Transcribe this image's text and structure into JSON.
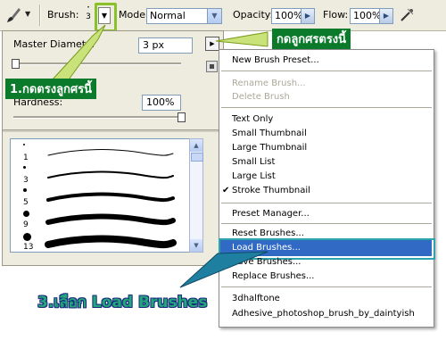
{
  "toolbar": {
    "tool_icon": "paintbrush-icon",
    "brush_label": "Brush:",
    "brush_size": "3",
    "mode_label": "Mode:",
    "mode_value": "Normal",
    "opacity_label": "Opacity:",
    "opacity_value": "100%",
    "flow_label": "Flow:",
    "flow_value": "100%",
    "airbrush_icon": "airbrush-icon"
  },
  "brush_panel": {
    "master_diameter_label": "Master Diameter",
    "master_diameter_value": "3 px",
    "master_diameter_slider": 0.01,
    "hardness_label": "Hardness:",
    "hardness_value": "100%",
    "hardness_slider": 1.0,
    "brushes": [
      {
        "size": "1"
      },
      {
        "size": "3"
      },
      {
        "size": "5"
      },
      {
        "size": "9"
      },
      {
        "size": "13"
      }
    ]
  },
  "menu": {
    "items": [
      {
        "label": "New Brush Preset...",
        "enabled": true
      },
      {
        "label": "Rename Brush...",
        "enabled": false
      },
      {
        "label": "Delete Brush",
        "enabled": false
      },
      {
        "label": "Text Only",
        "enabled": true
      },
      {
        "label": "Small Thumbnail",
        "enabled": true
      },
      {
        "label": "Large Thumbnail",
        "enabled": true
      },
      {
        "label": "Small List",
        "enabled": true
      },
      {
        "label": "Large List",
        "enabled": true
      },
      {
        "label": "Stroke Thumbnail",
        "enabled": true,
        "checked": true
      },
      {
        "label": "Preset Manager...",
        "enabled": true
      },
      {
        "label": "Reset Brushes...",
        "enabled": true
      },
      {
        "label": "Load Brushes...",
        "enabled": true,
        "highlighted": true
      },
      {
        "label": "Save Brushes...",
        "enabled": true
      },
      {
        "label": "Replace Brushes...",
        "enabled": true
      },
      {
        "label": "3dhalftone",
        "enabled": true
      },
      {
        "label": "Adhesive_photoshop_brush_by_daintyish",
        "enabled": true
      }
    ]
  },
  "annotations": {
    "step1": "1.กดตรงลูกศรนี้",
    "step2": "กดลูกศรตรงนี้",
    "step3": "3.เลือก Load Brushes"
  },
  "colors": {
    "highlight": "#316ac5",
    "annotation_green": "#0b7a2a",
    "callout_border": "#8ac02a"
  }
}
